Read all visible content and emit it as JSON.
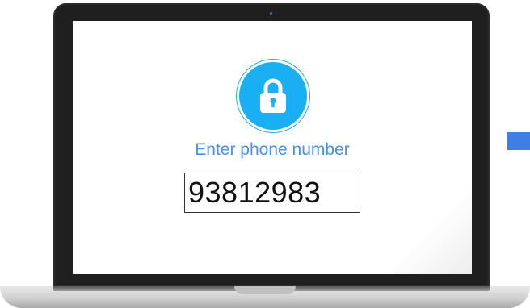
{
  "screen": {
    "prompt_label": "Enter phone number",
    "phone_input": {
      "value": "93812983",
      "placeholder": ""
    },
    "lock_icon": "lock-icon"
  },
  "colors": {
    "accent_blue": "#1aaef2",
    "prompt_text": "#4a90e6",
    "arrow": "#3e7fe4",
    "bezel": "#1f1f1f"
  }
}
